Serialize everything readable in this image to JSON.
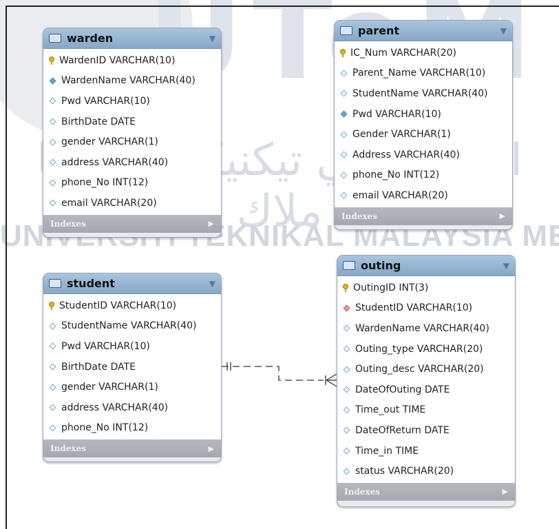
{
  "tables": [
    {
      "name": "warden",
      "columns": [
        {
          "text": "WardenID VARCHAR(10)",
          "icon": "primary-key-icon"
        },
        {
          "text": "WardenName VARCHAR(40)",
          "icon": "filled-diamond-icon"
        },
        {
          "text": "Pwd VARCHAR(10)",
          "icon": "diamond-icon"
        },
        {
          "text": "BirthDate DATE",
          "icon": "diamond-icon"
        },
        {
          "text": "gender VARCHAR(1)",
          "icon": "diamond-icon"
        },
        {
          "text": "address VARCHAR(40)",
          "icon": "diamond-icon"
        },
        {
          "text": "phone_No INT(12)",
          "icon": "diamond-icon"
        },
        {
          "text": "email VARCHAR(20)",
          "icon": "diamond-icon"
        }
      ],
      "footer": "Indexes"
    },
    {
      "name": "parent",
      "columns": [
        {
          "text": "IC_Num VARCHAR(20)",
          "icon": "primary-key-icon"
        },
        {
          "text": "Parent_Name VARCHAR(10)",
          "icon": "diamond-icon"
        },
        {
          "text": "StudentName VARCHAR(40)",
          "icon": "diamond-icon"
        },
        {
          "text": "Pwd VARCHAR(10)",
          "icon": "filled-diamond-icon"
        },
        {
          "text": "Gender VARCHAR(1)",
          "icon": "diamond-icon"
        },
        {
          "text": "Address VARCHAR(40)",
          "icon": "diamond-icon"
        },
        {
          "text": "phone_No INT(12)",
          "icon": "diamond-icon"
        },
        {
          "text": "email VARCHAR(20)",
          "icon": "diamond-icon"
        }
      ],
      "footer": "Indexes"
    },
    {
      "name": "student",
      "columns": [
        {
          "text": "StudentID VARCHAR(10)",
          "icon": "primary-key-icon"
        },
        {
          "text": "StudentName VARCHAR(40)",
          "icon": "diamond-icon"
        },
        {
          "text": "Pwd VARCHAR(10)",
          "icon": "diamond-icon"
        },
        {
          "text": "BirthDate DATE",
          "icon": "diamond-icon"
        },
        {
          "text": "gender VARCHAR(1)",
          "icon": "diamond-icon"
        },
        {
          "text": "address VARCHAR(40)",
          "icon": "diamond-icon"
        },
        {
          "text": "phone_No INT(12)",
          "icon": "diamond-icon"
        }
      ],
      "footer": "Indexes"
    },
    {
      "name": "outing",
      "columns": [
        {
          "text": "OutingID INT(3)",
          "icon": "primary-key-icon"
        },
        {
          "text": "StudentID VARCHAR(10)",
          "icon": "foreign-key-diamond-icon"
        },
        {
          "text": "WardenName VARCHAR(40)",
          "icon": "diamond-icon"
        },
        {
          "text": "Outing_type VARCHAR(20)",
          "icon": "diamond-icon"
        },
        {
          "text": "Outing_desc VARCHAR(20)",
          "icon": "diamond-icon"
        },
        {
          "text": "DateOfOuting DATE",
          "icon": "diamond-icon"
        },
        {
          "text": "Time_out TIME",
          "icon": "diamond-icon"
        },
        {
          "text": "DateOfReturn DATE",
          "icon": "diamond-icon"
        },
        {
          "text": "Time_in TIME",
          "icon": "diamond-icon"
        },
        {
          "text": "status VARCHAR(20)",
          "icon": "diamond-icon"
        }
      ],
      "footer": "Indexes"
    }
  ],
  "relationships": [
    {
      "from": "student",
      "to": "outing",
      "from_end": "one-mandatory",
      "to_end": "one-or-many"
    }
  ],
  "watermark": {
    "logo_text": "UTeM",
    "jawi": "اونيۏرسيتي تيكنيكل مليسيا ملاك",
    "university": "UNIVERSITI TEKNIKAL MALAYSIA MELAKA"
  },
  "colors": {
    "header": "#9dbbd8",
    "footer": "#adb1b7",
    "key": "#e3b21a",
    "fk": "#e99aa4",
    "diamond": "#6fa6cf"
  }
}
